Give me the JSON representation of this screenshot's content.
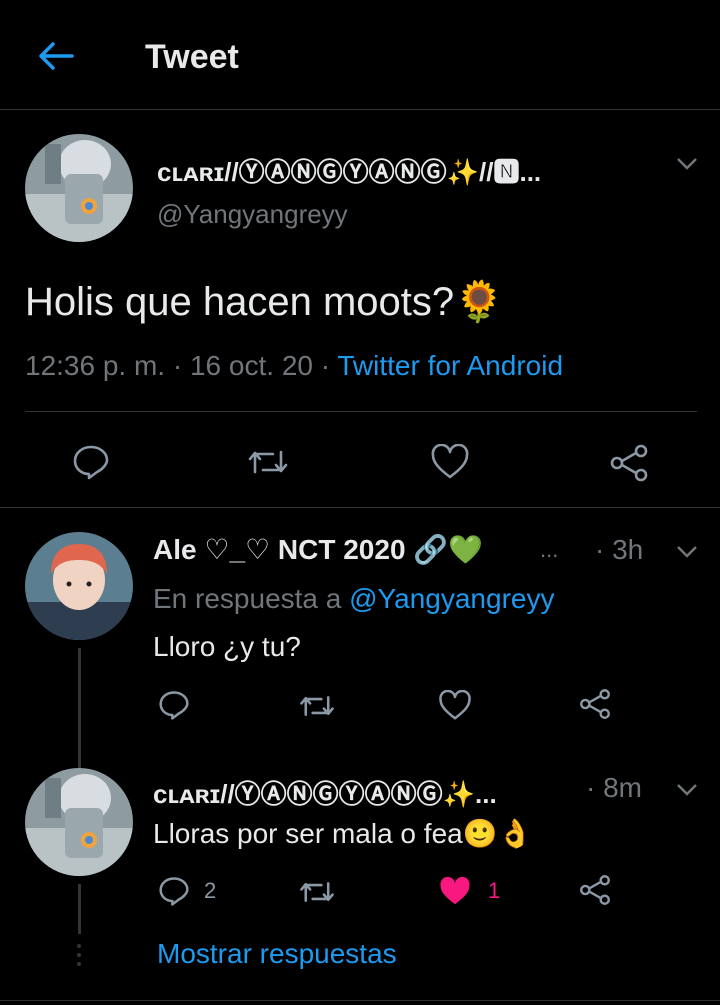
{
  "header": {
    "title": "Tweet",
    "back_icon": "arrow-left-icon"
  },
  "main_tweet": {
    "author_name": "ᴄʟᴀʀɪ//ⓎⒶⓃⒼⓎⒶⓃⒼ✨//🅽...",
    "handle": "@Yangyangreyy",
    "text": "Holis que hacen moots?🌻",
    "time": "12:36 p. m.",
    "sep1": "·",
    "date": "16 oct. 20",
    "sep2": "·",
    "source": "Twitter for Android"
  },
  "replies": [
    {
      "author_name": "Ale ♡_♡ NCT 2020 🔗💚",
      "ellipsis": "...",
      "time": "· 3h",
      "reply_prefix": "En respuesta a",
      "reply_to": "@Yangyangreyy",
      "text": "Lloro ¿y tu?"
    },
    {
      "author_name": "ᴄʟᴀʀɪ//ⓎⒶⓃⒼⓎⒶⓃⒼ✨...",
      "time": "· 8m",
      "text": "Lloras por ser mala o fea🙂👌",
      "reply_count": "2",
      "like_count": "1",
      "show_replies": "Mostrar respuestas"
    }
  ],
  "colors": {
    "accent": "#1d9bf0",
    "like_active": "#f91880",
    "background": "#000000"
  }
}
